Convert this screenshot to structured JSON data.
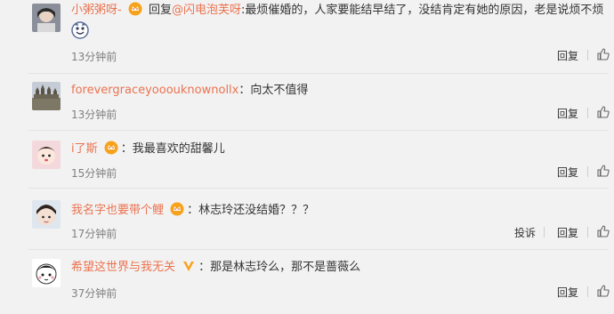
{
  "comments": [
    {
      "user": "小粥粥呀-",
      "has_badge": true,
      "reply_prefix": "回复",
      "mention": "@闪电泡芙呀",
      "text": ":最烦催婚的，人家要能结早结了，没结肯定有她的原因，老是说烦不烦",
      "time": "13分钟前",
      "reply_label": "回复"
    },
    {
      "user": "forevergraceyooouknownollx",
      "has_badge": false,
      "text": "：向太不值得",
      "time": "13分钟前",
      "reply_label": "回复"
    },
    {
      "user": "i了斯",
      "has_badge": true,
      "text": "：我最喜欢的甜馨儿",
      "time": "15分钟前",
      "reply_label": "回复"
    },
    {
      "user": "我名字也要带个鲤",
      "has_badge": true,
      "text": "：林志玲还没结婚？？？",
      "time": "17分钟前",
      "report_label": "投诉",
      "reply_label": "回复"
    },
    {
      "user": "希望这世界与我无关",
      "has_badge": true,
      "badge_type": "vip",
      "text": "：那是林志玲么，那不是蔷薇么",
      "time": "37分钟前",
      "reply_label": "回复"
    }
  ],
  "icons": {
    "like": "thumbs-up-icon",
    "badge": "member-crown-icon",
    "sticker": "cute-sticker-icon"
  },
  "colors": {
    "username": "#eb7350",
    "time": "#808080",
    "background": "#f2f2f2"
  }
}
